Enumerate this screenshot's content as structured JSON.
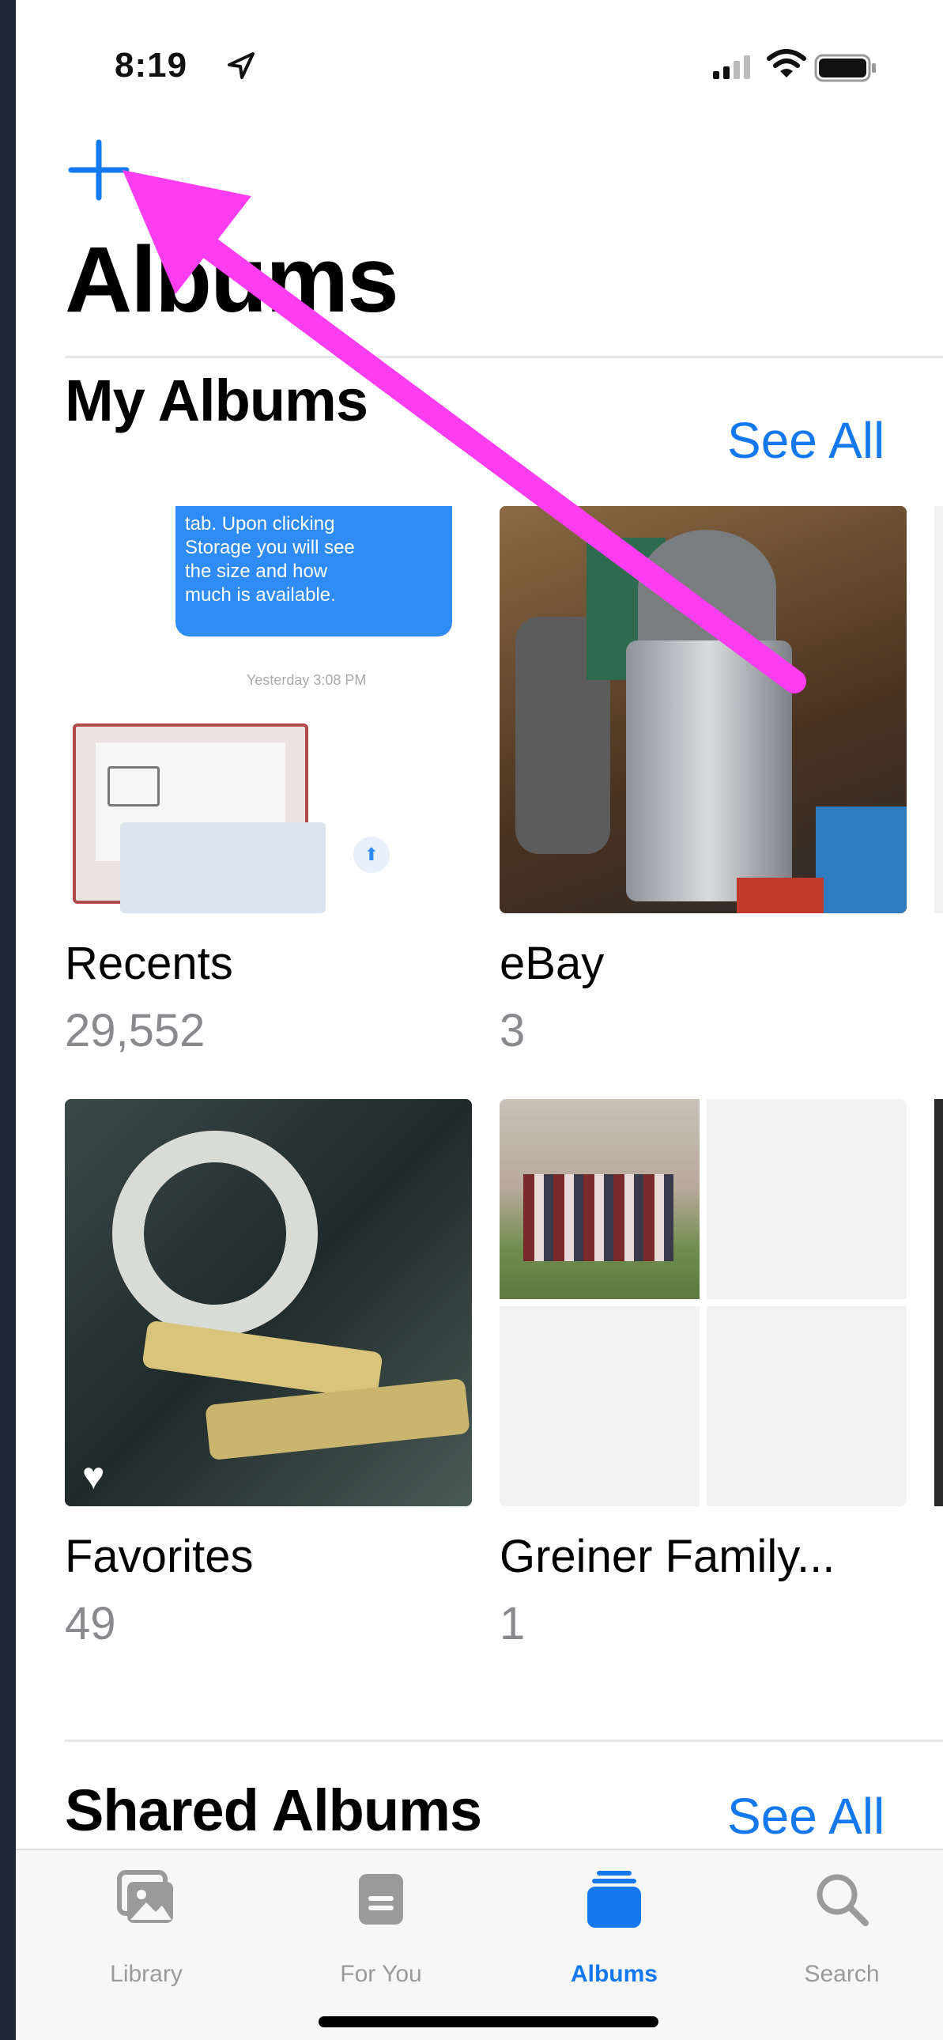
{
  "status_bar": {
    "time": "8:19"
  },
  "header": {
    "title": "Albums"
  },
  "my_albums": {
    "heading": "My Albums",
    "see_all": "See All",
    "albums": [
      {
        "name": "Recents",
        "count": "29,552",
        "thumb_text": [
          "tab. Upon clicking",
          "Storage you will see",
          "the size and how",
          "much is available."
        ],
        "thumb_timestamp": "Yesterday 3:08 PM"
      },
      {
        "name": "eBay",
        "count": "3"
      },
      {
        "name": "Favorites",
        "count": "49"
      },
      {
        "name": "Greiner Family...",
        "count": "1"
      }
    ]
  },
  "shared_albums": {
    "heading": "Shared Albums",
    "see_all": "See All"
  },
  "tab_bar": {
    "tabs": [
      {
        "label": "Library",
        "icon": "photo-library-icon"
      },
      {
        "label": "For You",
        "icon": "for-you-icon"
      },
      {
        "label": "Albums",
        "icon": "albums-icon",
        "active": true
      },
      {
        "label": "Search",
        "icon": "search-icon"
      }
    ]
  },
  "colors": {
    "accent": "#1478f0",
    "annotation_arrow": "#ff3df0",
    "background": "#1f2636"
  }
}
